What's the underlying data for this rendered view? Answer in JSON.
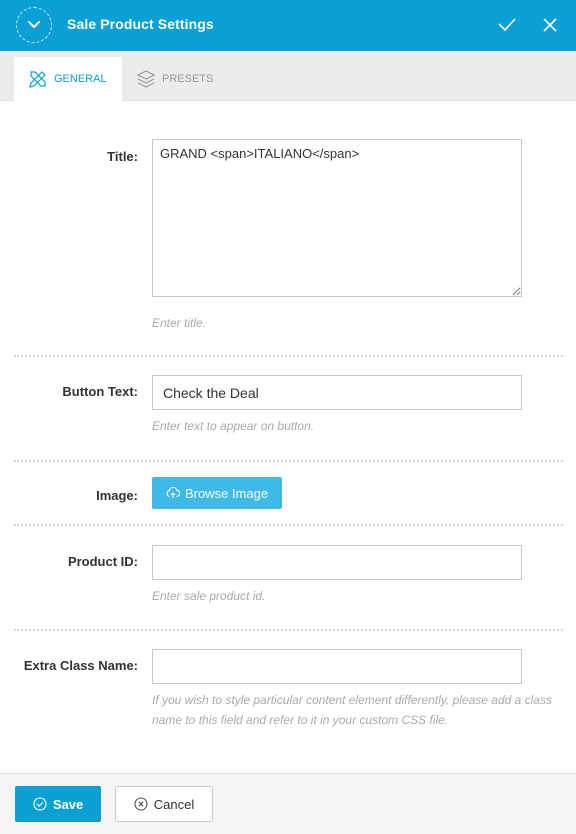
{
  "dialog": {
    "title": "Sale Product Settings",
    "accent_color": "#0aa0d6",
    "header_icons": [
      "chevron-down-icon",
      "check-icon",
      "close-icon"
    ]
  },
  "tabs": [
    {
      "label": "General",
      "icon": "pencil-ruler-icon",
      "active": true
    },
    {
      "label": "Presets",
      "icon": "layers-icon",
      "active": false
    }
  ],
  "fields": {
    "title": {
      "label": "Title:",
      "value": "GRAND <span>ITALIANO</span>",
      "help": "Enter title."
    },
    "button_text": {
      "label": "Button Text:",
      "value": "Check the Deal",
      "help": "Enter text to appear on button."
    },
    "image": {
      "label": "Image:",
      "button_label": "Browse Image",
      "icon": "cloud-upload-icon"
    },
    "product_id": {
      "label": "Product ID:",
      "value": "",
      "help": "Enter sale product id."
    },
    "extra_class": {
      "label": "Extra Class Name:",
      "value": "",
      "help": "If you wish to style particular content element differently, please add a class name to this field and refer to it in your custom CSS file."
    }
  },
  "footer": {
    "save_label": "Save",
    "cancel_label": "Cancel"
  }
}
